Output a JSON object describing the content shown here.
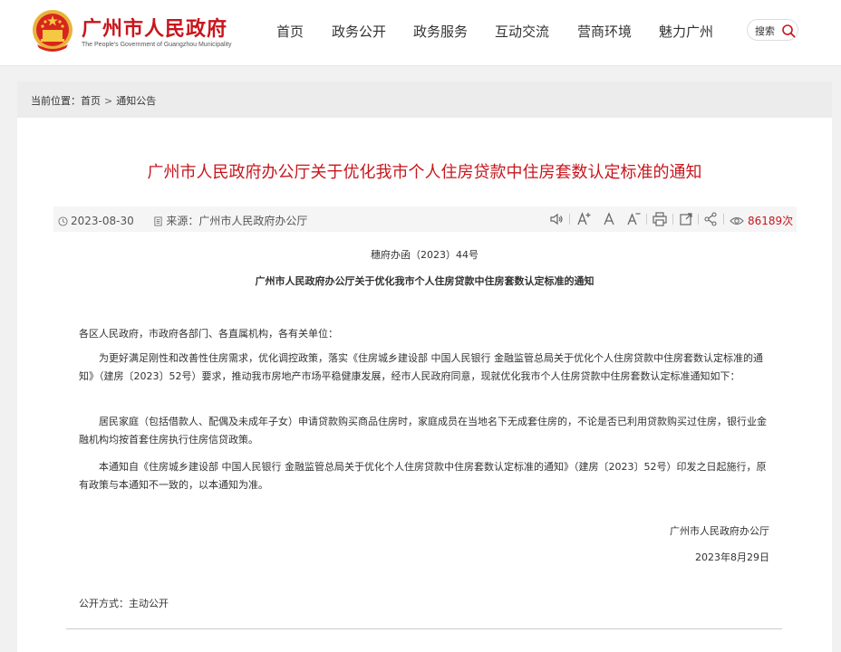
{
  "header": {
    "site_name": "广州市人民政府",
    "site_en": "The People's Government of Guangzhou Municipality",
    "nav": [
      "首页",
      "政务公开",
      "政务服务",
      "互动交流",
      "营商环境",
      "魅力广州"
    ],
    "search_label": "搜索"
  },
  "breadcrumb": {
    "prefix": "当前位置：",
    "items": [
      "首页",
      "通知公告"
    ],
    "separator": ">"
  },
  "article": {
    "title": "广州市人民政府办公厅关于优化我市个人住房贷款中住房套数认定标准的通知",
    "date": "2023-08-30",
    "source_label": "来源：",
    "source": "广州市人民政府办公厅",
    "views": "86189次",
    "doc_number": "穗府办函（2023）44号",
    "doc_title": "广州市人民政府办公厅关于优化我市个人住房贷款中住房套数认定标准的通知",
    "salutation": "各区人民政府，市政府各部门、各直属机构，各有关单位：",
    "paragraphs": [
      "为更好满足刚性和改善性住房需求，优化调控政策，落实《住房城乡建设部 中国人民银行 金融监管总局关于优化个人住房贷款中住房套数认定标准的通知》（建房〔2023〕52号）要求，推动我市房地产市场平稳健康发展，经市人民政府同意，现就优化我市个人住房贷款中住房套数认定标准通知如下：",
      "居民家庭（包括借款人、配偶及未成年子女）申请贷款购买商品住房时，家庭成员在当地名下无成套住房的，不论是否已利用贷款购买过住房，银行业金融机构均按首套住房执行住房信贷政策。",
      "本通知自《住房城乡建设部 中国人民银行 金融监管总局关于优化个人住房贷款中住房套数认定标准的通知》（建房〔2023〕52号）印发之日起施行，原有政策与本通知不一致的，以本通知为准。"
    ],
    "signature": "广州市人民政府办公厅",
    "sign_date": "2023年8月29日",
    "publish_mode": "公开方式：主动公开"
  },
  "colors": {
    "brand_red": "#c8161d",
    "page_bg": "#f1f1f1",
    "crumb_bg": "#ececec",
    "info_bg": "#f5f5f5"
  },
  "icons": [
    "national-emblem-icon",
    "search-icon",
    "clock-icon",
    "document-icon",
    "speaker-icon",
    "font-larger-icon",
    "font-normal-icon",
    "font-smaller-icon",
    "print-icon",
    "share-external-icon",
    "share-icon",
    "eye-icon"
  ]
}
